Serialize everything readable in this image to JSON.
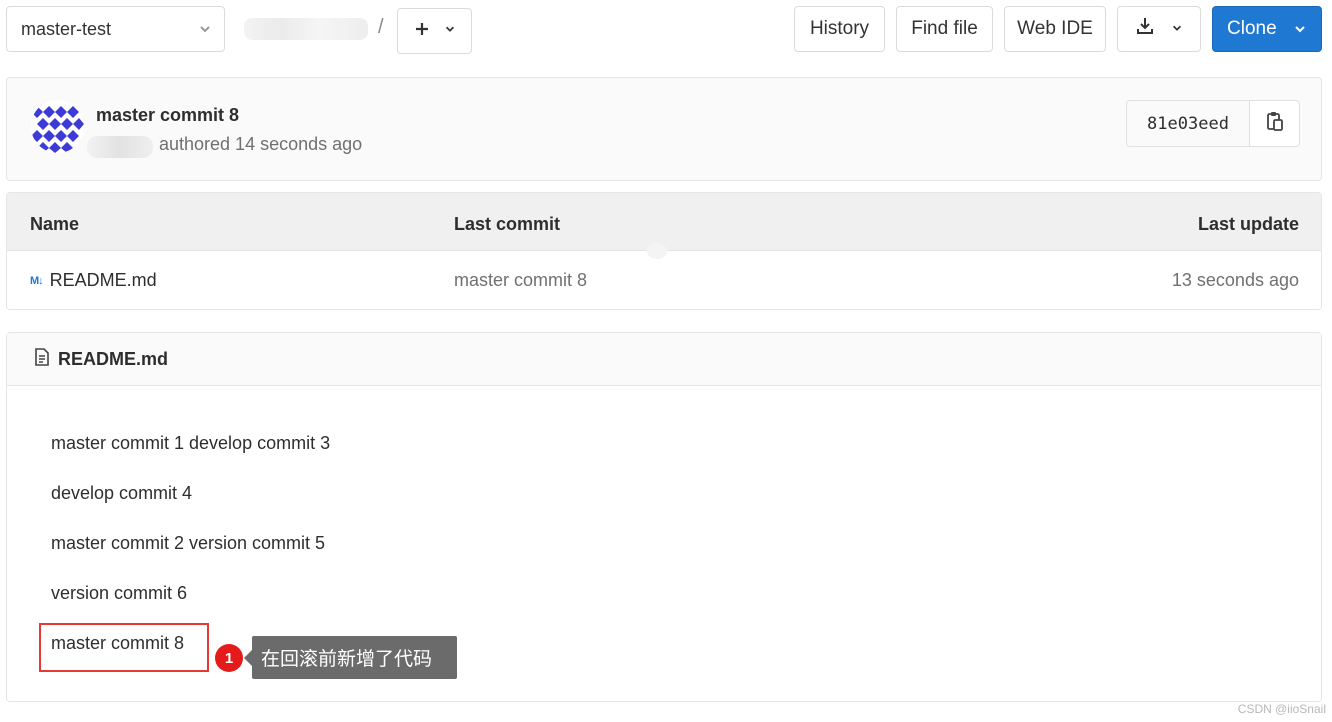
{
  "topbar": {
    "branch": "master-test",
    "separator": "/",
    "add_icon": "plus-icon",
    "buttons": {
      "history": "History",
      "find_file": "Find file",
      "web_ide": "Web IDE",
      "clone": "Clone"
    },
    "clone_color": "#1f78d1"
  },
  "commit": {
    "title": "master commit 8",
    "meta": "authored 14 seconds ago",
    "sha": "81e03eed",
    "copy_icon": "clipboard-icon"
  },
  "files": {
    "headers": {
      "name": "Name",
      "last_commit": "Last commit",
      "last_update": "Last update"
    },
    "rows": [
      {
        "icon": "markdown-icon",
        "icon_text": "M↓",
        "name": "README.md",
        "last_commit": "master commit 8",
        "last_update": "13 seconds ago"
      }
    ]
  },
  "readme": {
    "title": "README.md",
    "lines": [
      "master commit 1 develop commit 3",
      "develop commit 4",
      "master commit 2 version commit 5",
      "version commit 6",
      "master commit 8"
    ],
    "annotation": {
      "badge": "1",
      "text": "在回滚前新增了代码",
      "box_color": "#e53935"
    }
  },
  "watermark": "CSDN @iioSnail"
}
